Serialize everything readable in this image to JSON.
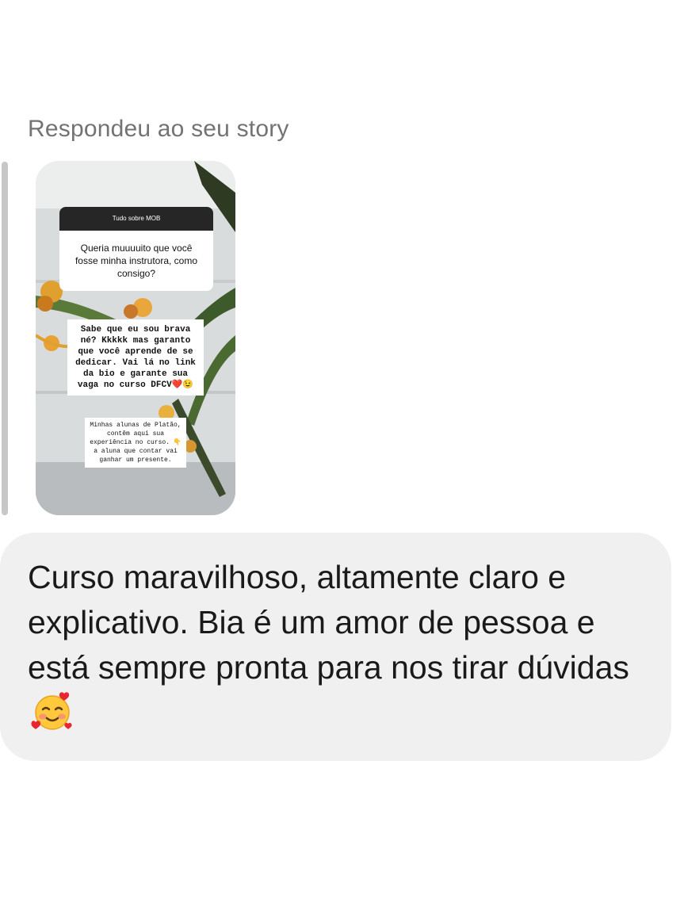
{
  "reply": {
    "header": "Respondeu ao seu story"
  },
  "story": {
    "question_title": "Tudo sobre MOB",
    "question_text": "Queria muuuuito que você fosse minha instrutora, como consigo?",
    "answer_text": "Sabe que eu sou brava né? Kkkkk mas garanto que você aprende de se dedicar. Vai lá no link da bio e garante sua vaga no curso DFCV",
    "answer_emojis": "❤️😉",
    "caption_text_1": "Minhas alunas de Platão, contêm aqui sua experiência no curso.",
    "caption_emoji": "👇",
    "caption_text_2": "a aluna que contar vai ganhar um presente."
  },
  "message": {
    "text": "Curso maravilhoso, altamente claro e explicativo. Bia é um amor de pessoa e está sempre pronta para nos tirar dúvidas",
    "emoji_icon": "smiling-face-with-hearts-icon"
  },
  "colors": {
    "header_gray": "#737373",
    "bubble_bg": "#f0f0f0",
    "reply_bar": "#c7c7c7"
  }
}
